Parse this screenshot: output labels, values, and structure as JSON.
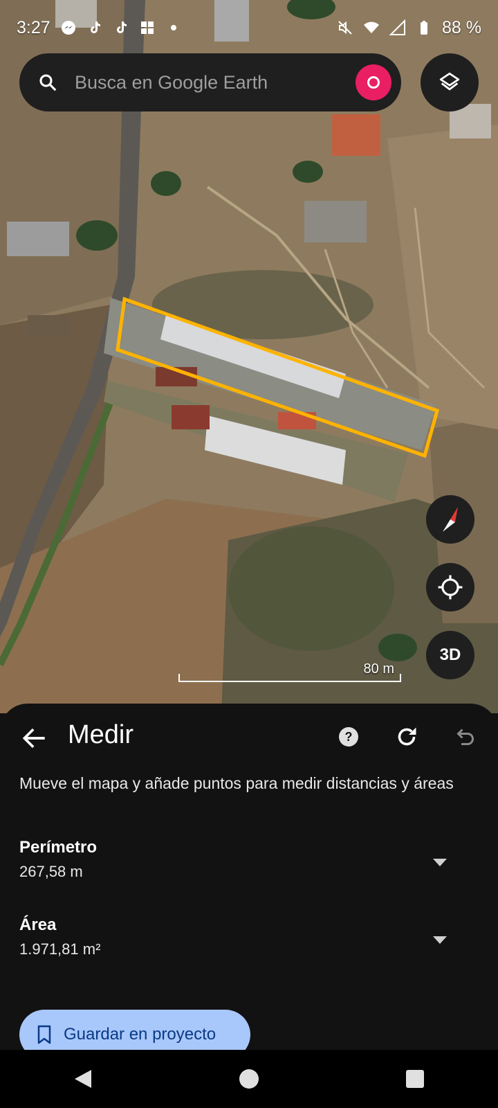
{
  "status_bar": {
    "time": "3:27",
    "battery": "88 %",
    "icons": [
      "messenger-icon",
      "tiktok-icon",
      "tiktok-icon",
      "grid-app-icon",
      "dot-icon",
      "mute-icon",
      "wifi-icon",
      "signal-icon",
      "battery-icon"
    ]
  },
  "search": {
    "placeholder": "Busca en Google Earth",
    "icon": "search-icon"
  },
  "map": {
    "scale_label": "80 m",
    "polygon_color": "#ffb300",
    "controls": {
      "compass": "compass-icon",
      "locate": "my-location-icon",
      "view_3d_label": "3D"
    }
  },
  "sheet": {
    "title": "Medir",
    "hint": "Mueve el mapa y añade puntos para medir distancias y áreas",
    "perimeter": {
      "label": "Perímetro",
      "value": "267,58 m"
    },
    "area": {
      "label": "Área",
      "value": "1.971,81 m²"
    },
    "save_label": "Guardar en proyecto",
    "help_label": "?"
  },
  "colors": {
    "sheet_bg": "#121212",
    "button_bg": "#a8c7fa",
    "avatar": "#e91e63"
  }
}
